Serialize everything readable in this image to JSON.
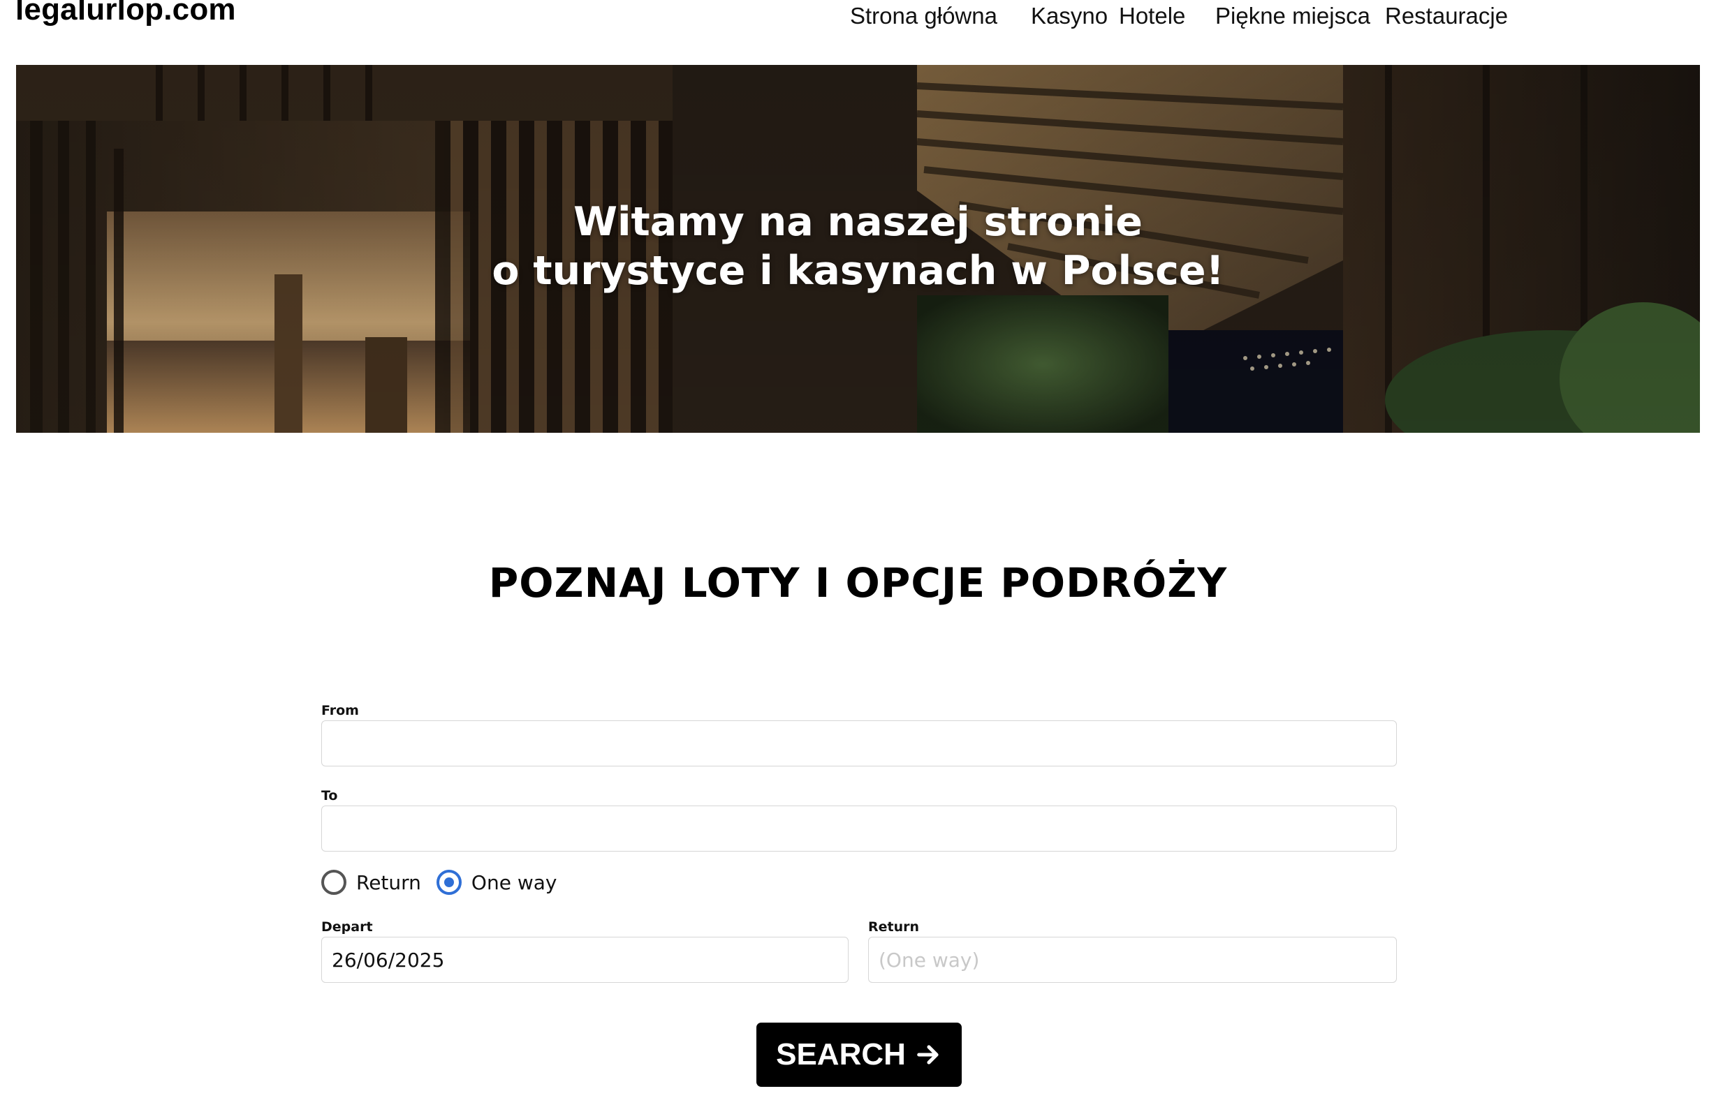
{
  "site": {
    "logo": "legalurlop.com"
  },
  "nav": {
    "items": [
      {
        "label": "Strona główna"
      },
      {
        "label": "Kasyno"
      },
      {
        "label": "Hotele"
      },
      {
        "label": "Piękne miejsca"
      },
      {
        "label": "Restauracje"
      }
    ]
  },
  "hero": {
    "title_line1": "Witamy na naszej stronie",
    "title_line2": "o turystyce i kasynach w Polsce!",
    "image_icon": "hotel-terrace-photo"
  },
  "section": {
    "title": "POZNAJ LOTY I OPCJE PODRÓŻY"
  },
  "form": {
    "from_label": "From",
    "from_value": "",
    "to_label": "To",
    "to_value": "",
    "trip_type": {
      "options": [
        {
          "label": "Return",
          "checked": false
        },
        {
          "label": "One way",
          "checked": true
        }
      ]
    },
    "depart_label": "Depart",
    "depart_value": "26/06/2025",
    "return_label": "Return",
    "return_value": "",
    "return_placeholder": "(One way)",
    "search_label": "SEARCH",
    "search_icon": "arrow-right-icon"
  },
  "colors": {
    "accent": "#2f6fd6",
    "button": "#000000",
    "border": "#d6d6d6"
  }
}
